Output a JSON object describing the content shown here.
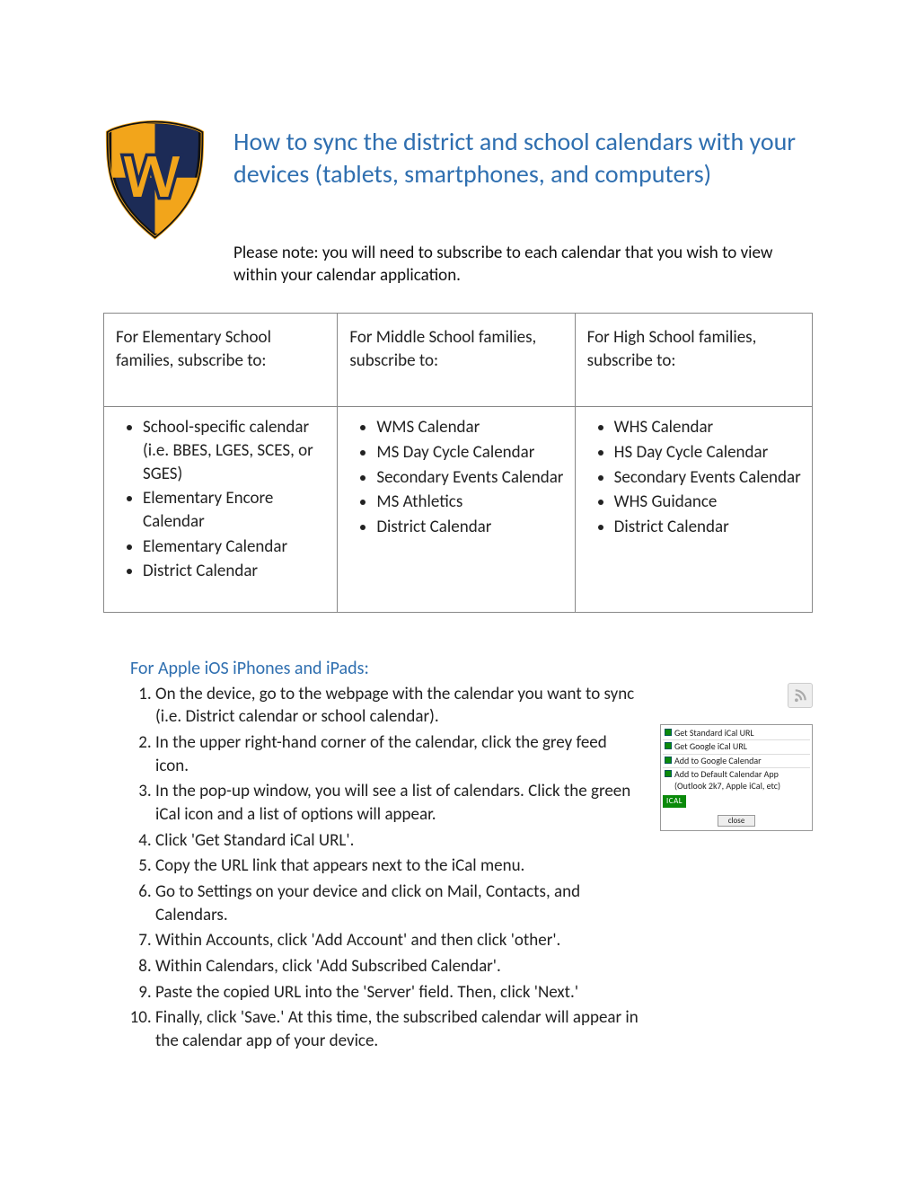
{
  "title": "How to sync the district and school calendars with your devices (tablets, smartphones, and computers)",
  "note": "Please note: you will need to subscribe to each calendar that you wish to view within your calendar application.",
  "table_headings": {
    "a": "For Elementary School families, subscribe to:",
    "b": "For Middle School families, subscribe to:",
    "c": "For High School families, subscribe to:"
  },
  "col_a_items": [
    "School-specific calendar (i.e. BBES, LGES, SCES, or SGES)",
    "Elementary Encore Calendar",
    "Elementary Calendar",
    "District Calendar"
  ],
  "col_b_items": [
    "WMS Calendar",
    "MS Day Cycle Calendar",
    "Secondary Events Calendar",
    "MS Athletics",
    "District Calendar"
  ],
  "col_c_items": [
    "WHS Calendar",
    "HS Day Cycle Calendar",
    "Secondary Events Calendar",
    "WHS Guidance",
    "District Calendar"
  ],
  "section_heading": "For Apple iOS iPhones and iPads:",
  "steps": [
    "On the device, go to the webpage with the calendar you want to sync (i.e. District calendar or school calendar).",
    "In the upper right-hand corner of the calendar, click the grey feed icon.",
    "In the pop-up window, you will see a list of calendars. Click the green iCal icon and a list of options will appear.",
    "Click 'Get Standard iCal URL'.",
    "Copy the URL link that appears next to the iCal menu.",
    "Go to Settings on your device and click on Mail, Contacts, and Calendars.",
    "Within Accounts, click 'Add Account' and then click 'other'.",
    "Within Calendars, click 'Add Subscribed Calendar'.",
    "Paste the copied URL into the 'Server' field. Then, click 'Next.'",
    "Finally, click 'Save.' At this time, the subscribed calendar will appear in the calendar app of your device."
  ],
  "popup_options": [
    "Get Standard iCal URL",
    "Get Google iCal URL",
    "Add to Google Calendar",
    "Add to Default Calendar App (Outlook 2k7, Apple iCal, etc)"
  ],
  "ical_label": "ICAL",
  "close_label": "close"
}
